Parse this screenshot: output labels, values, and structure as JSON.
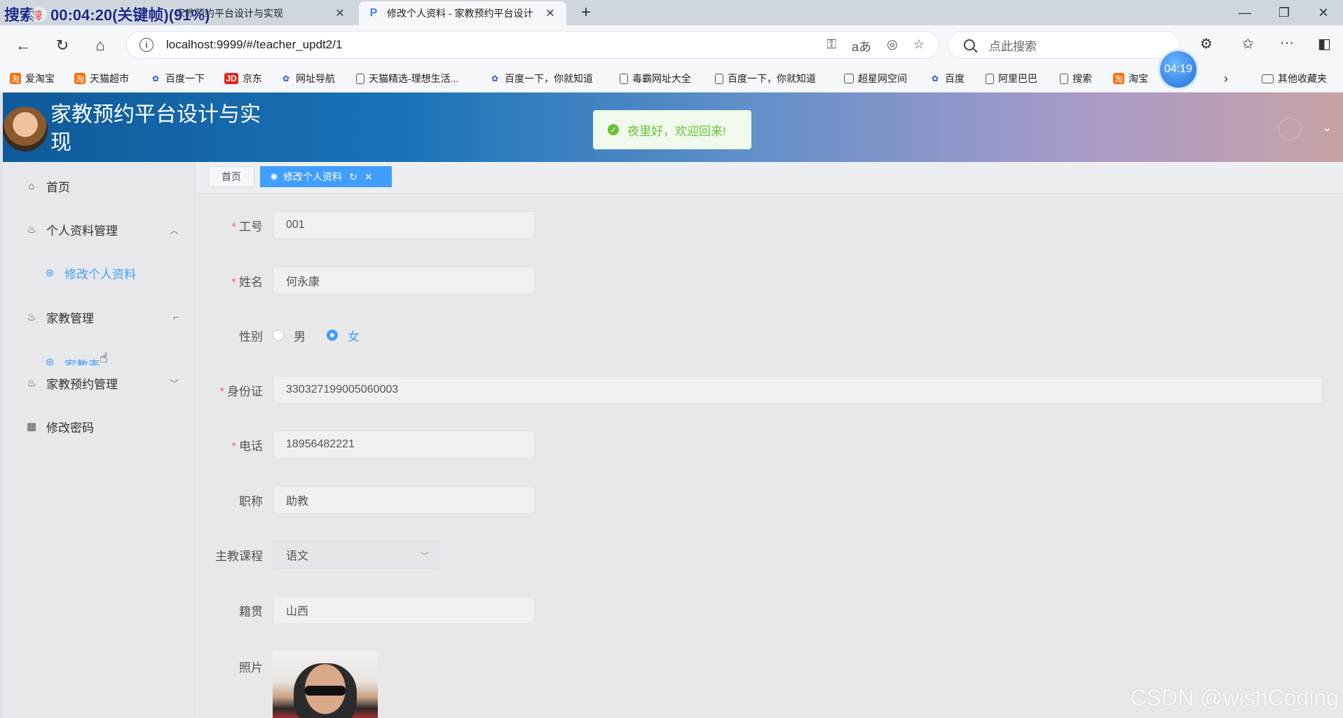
{
  "overlay": {
    "recording_text": "搜索：00:04:20(关键帧)(91%)",
    "rec_badge": "录",
    "timer": "04:19"
  },
  "browser": {
    "tabs": [
      {
        "title": "家教预约平台设计与实现",
        "active": false
      },
      {
        "title": "修改个人资料 - 家教预约平台设计",
        "active": true
      }
    ],
    "url": "localhost:9999/#/teacher_updt2/1",
    "search_placeholder": "点此搜索",
    "bookmarks": [
      {
        "label": "爱淘宝",
        "icon": "taobao-icon"
      },
      {
        "label": "天猫超市",
        "icon": "taobao-icon"
      },
      {
        "label": "百度一下",
        "icon": "baidu-paw-icon"
      },
      {
        "label": "京东",
        "icon": "jd-icon"
      },
      {
        "label": "网址导航",
        "icon": "baidu-paw-icon"
      },
      {
        "label": "天猫精选-理想生活...",
        "icon": "page-icon"
      },
      {
        "label": "百度一下，你就知道",
        "icon": "baidu-paw-icon"
      },
      {
        "label": "毒霸网址大全",
        "icon": "page-icon"
      },
      {
        "label": "百度一下，你就知道",
        "icon": "page-icon"
      },
      {
        "label": "超星网空间",
        "icon": "globe-icon"
      },
      {
        "label": "百度",
        "icon": "baidu-paw-icon"
      },
      {
        "label": "阿里巴巴",
        "icon": "page-icon"
      },
      {
        "label": "搜索",
        "icon": "page-icon"
      },
      {
        "label": "淘宝",
        "icon": "taobao-icon"
      }
    ],
    "other_bookmarks": "其他收藏夹",
    "tab_jd_text": "JD"
  },
  "app": {
    "title": "家教预约平台设计与实现",
    "toast": "夜里好，欢迎回来!"
  },
  "sidebar": {
    "items": [
      {
        "label": "首页",
        "icon": "home-icon"
      },
      {
        "label": "个人资料管理",
        "icon": "cup-icon"
      },
      {
        "label": "修改个人资料",
        "icon": "gear-icon"
      },
      {
        "label": "家教管理",
        "icon": "cup-icon"
      },
      {
        "label": "家教表",
        "icon": "gear-icon"
      },
      {
        "label": "家教预约管理",
        "icon": "cup-icon"
      },
      {
        "label": "修改密码",
        "icon": "grid-icon"
      }
    ]
  },
  "tags": {
    "home": "首页",
    "active": "修改个人资料"
  },
  "form": {
    "id_label": "工号",
    "id_value": "001",
    "name_label": "姓名",
    "name_value": "何永康",
    "gender_label": "性别",
    "gender_options": [
      "男",
      "女"
    ],
    "gender_selected": "女",
    "idcard_label": "身份证",
    "idcard_value": "330327199005060003",
    "phone_label": "电话",
    "phone_value": "18956482221",
    "title_label": "职称",
    "title_value": "助教",
    "course_label": "主教课程",
    "course_value": "语文",
    "hometown_label": "籍贯",
    "hometown_value": "山西",
    "photo_label": "照片"
  },
  "watermark": "CSDN @wishCoding",
  "colors": {
    "accent": "#409eff",
    "success": "#67c23a",
    "required": "#f56c6c"
  }
}
